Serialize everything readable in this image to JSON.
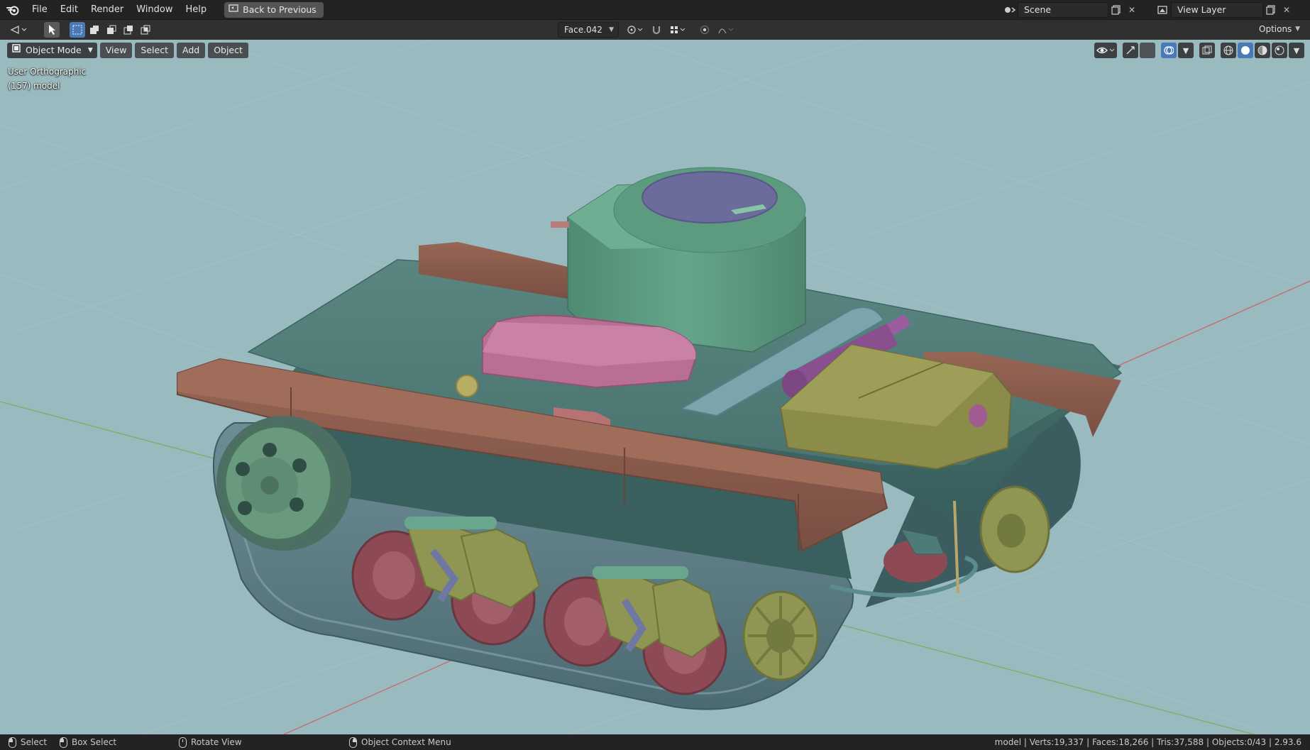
{
  "menu": {
    "items": [
      "File",
      "Edit",
      "Render",
      "Window",
      "Help"
    ],
    "back_button": "Back to Previous"
  },
  "scene": {
    "label": "Scene"
  },
  "view_layer": {
    "label": "View Layer"
  },
  "toolbar": {
    "face_dropdown": "Face.042",
    "options_label": "Options"
  },
  "viewport": {
    "mode": "Object Mode",
    "menus": [
      "View",
      "Select",
      "Add",
      "Object"
    ],
    "view_name": "User Orthographic",
    "object_info": "(157) model",
    "background_color": "#99babe"
  },
  "statusbar": {
    "select": "Select",
    "box_select": "Box Select",
    "rotate_view": "Rotate View",
    "context_menu": "Object Context Menu",
    "stats": "model | Verts:19,337 | Faces:18,266 | Tris:37,588 | Objects:0/43 | 2.93.6"
  },
  "colors": {
    "hull": "#4d7b77",
    "fender": "#8a5b4d",
    "turret": "#5f9a82",
    "hatch_pink": "#b86f93",
    "engine_cover": "#8b8b4a",
    "wheel_red": "#8d4a55",
    "bogie_olive": "#8f9552"
  }
}
